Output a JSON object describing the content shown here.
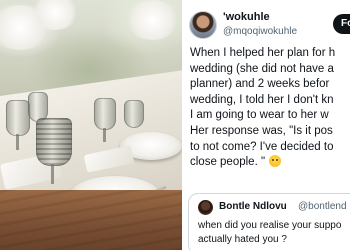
{
  "tweet": {
    "display_name": "'wokuhle",
    "handle": "@mqoqiwokuhle",
    "follow_label": "Fo",
    "body_lines": [
      "When I helped her plan for h",
      "wedding (she did not have a",
      "planner) and 2 weeks befor",
      "wedding, I told her I don't kn",
      "I am going to wear to her w",
      "Her response was, \"Is it pos",
      "to not come? I've decided to",
      "close people. \""
    ],
    "emoji": "sad-face"
  },
  "quoted_tweet": {
    "display_name": "Bontle Ndlovu",
    "handle": "@bontlend",
    "text_lines": [
      "when did you realise your suppo",
      "actually hated you ?"
    ]
  },
  "photo": {
    "subject": "wedding table setting with glasses, plates and napkins"
  }
}
